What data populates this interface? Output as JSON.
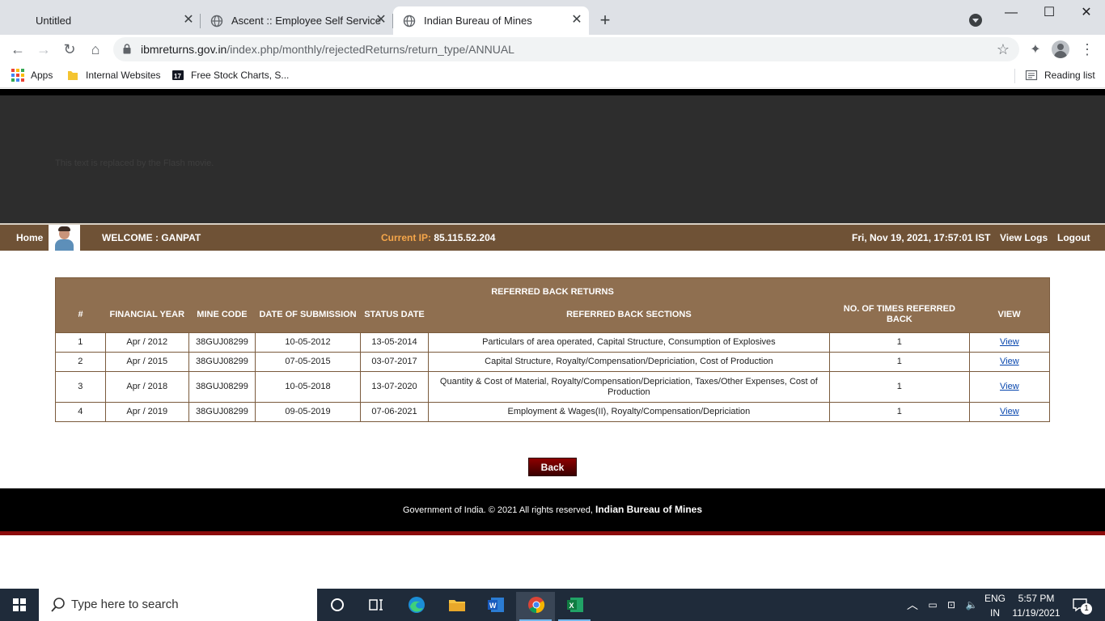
{
  "browser": {
    "tabs": [
      {
        "title": "Untitled",
        "active": false
      },
      {
        "title": "Ascent :: Employee Self Service",
        "active": false
      },
      {
        "title": "Indian Bureau of Mines",
        "active": true
      }
    ],
    "url_host": "ibmreturns.gov.in",
    "url_path": "/index.php/monthly/rejectedReturns/return_type/ANNUAL",
    "bookmarks": [
      {
        "label": "Apps",
        "icon": "apps-grid-icon"
      },
      {
        "label": "Internal Websites",
        "icon": "folder-icon"
      },
      {
        "label": "Free Stock Charts, S...",
        "icon": "tradingview-icon"
      }
    ],
    "reading_list": "Reading list"
  },
  "page": {
    "flash_placeholder": "This text is replaced by the Flash movie.",
    "nav": {
      "home": "Home",
      "welcome": "WELCOME : GANPAT",
      "ip_label": "Current IP:",
      "ip_value": "85.115.52.204",
      "datetime": "Fri, Nov 19, 2021, 17:57:01 IST",
      "view_logs": "View Logs",
      "logout": "Logout"
    },
    "table": {
      "caption": "REFERRED BACK RETURNS",
      "headers": [
        "#",
        "FINANCIAL YEAR",
        "MINE CODE",
        "DATE OF SUBMISSION",
        "STATUS DATE",
        "REFERRED BACK SECTIONS",
        "NO. OF TIMES REFERRED BACK",
        "VIEW"
      ],
      "rows": [
        {
          "num": "1",
          "year": "Apr / 2012",
          "mine_code": "38GUJ08299",
          "submitted": "10-05-2012",
          "status_date": "13-05-2014",
          "sections": "Particulars of area operated, Capital Structure, Consumption of Explosives",
          "times": "1",
          "view": "View"
        },
        {
          "num": "2",
          "year": "Apr / 2015",
          "mine_code": "38GUJ08299",
          "submitted": "07-05-2015",
          "status_date": "03-07-2017",
          "sections": "Capital Structure, Royalty/Compensation/Depriciation, Cost of Production",
          "times": "1",
          "view": "View"
        },
        {
          "num": "3",
          "year": "Apr / 2018",
          "mine_code": "38GUJ08299",
          "submitted": "10-05-2018",
          "status_date": "13-07-2020",
          "sections": "Quantity & Cost of Material, Royalty/Compensation/Depriciation, Taxes/Other Expenses, Cost of Production",
          "times": "1",
          "view": "View"
        },
        {
          "num": "4",
          "year": "Apr / 2019",
          "mine_code": "38GUJ08299",
          "submitted": "09-05-2019",
          "status_date": "07-06-2021",
          "sections": "Employment & Wages(II), Royalty/Compensation/Depriciation",
          "times": "1",
          "view": "View"
        }
      ]
    },
    "back_label": "Back",
    "footer_text": "Government of India. © 2021 All rights reserved,",
    "footer_org": "Indian Bureau of Mines"
  },
  "taskbar": {
    "search_placeholder": "Type here to search",
    "lang_top": "ENG",
    "lang_bottom": "IN",
    "time": "5:57 PM",
    "date": "11/19/2021",
    "notification_count": "1"
  },
  "colors": {
    "nav_brown": "#6f5236",
    "table_header_brown": "#8f6f50",
    "ip_orange": "#f5a64a",
    "back_button_red": "#8e0000",
    "footer_stripe": "#8c0b0b"
  }
}
